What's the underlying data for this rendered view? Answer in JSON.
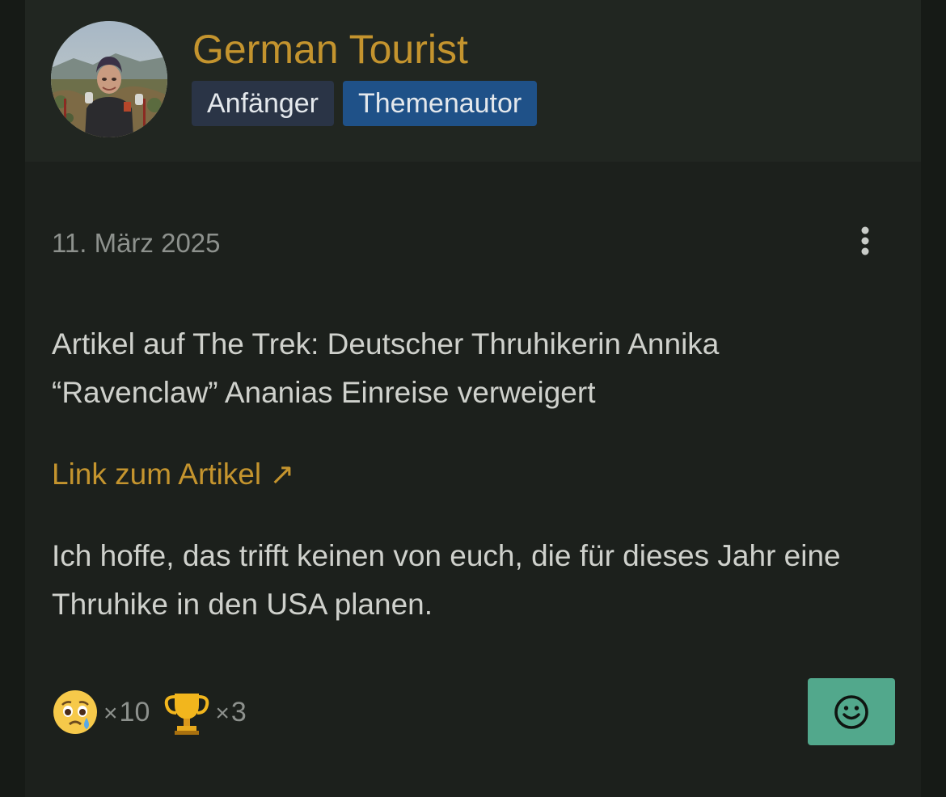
{
  "author": {
    "name": "German Tourist",
    "rank_badge": "Anfänger",
    "author_badge": "Themenautor",
    "avatar_icon": "user-photo"
  },
  "post": {
    "date": "11. März 2025",
    "text_1": "Artikel auf The Trek: Deutscher Thruhikerin Annika “Ravenclaw” Ananias Einreise verweigert",
    "link_text": "Link zum Artikel",
    "link_icon": "↗",
    "text_2": "Ich hoffe, das trifft keinen von euch, die für dieses Jahr eine Thruhike in den USA planen."
  },
  "reactions": [
    {
      "icon": "crying-face-icon",
      "times": "×",
      "count": "10"
    },
    {
      "icon": "trophy-icon",
      "times": "×",
      "count": "3"
    }
  ],
  "actions": {
    "more_icon": "vertical-dots-icon",
    "react_icon": "smiley-icon"
  },
  "colors": {
    "accent_gold": "#c4942e",
    "rank_badge_bg": "#2a3446",
    "author_badge_bg": "#1f5188",
    "react_button_bg": "#52a88c",
    "card_bg": "#1c201c",
    "header_bg": "#212621"
  }
}
